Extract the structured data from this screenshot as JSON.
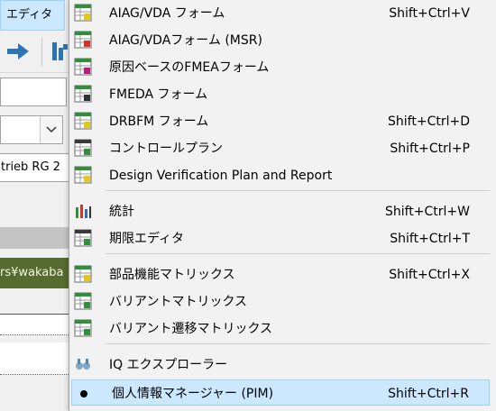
{
  "window": {
    "menu_tab": "エディタ",
    "partial_text_field": "trieb RG 2",
    "partial_path": "rs¥wakaba"
  },
  "menu": {
    "items": [
      {
        "label": "AIAG/VDA フォーム",
        "shortcut": "Shift+Ctrl+V",
        "icon": "aiag-vda-form-icon"
      },
      {
        "label": "AIAG/VDAフォーム (MSR)",
        "shortcut": "",
        "icon": "aiag-vda-msr-form-icon"
      },
      {
        "label": "原因ベースのFMEAフォーム",
        "shortcut": "",
        "icon": "cause-based-fmea-form-icon"
      },
      {
        "label": "FMEDA フォーム",
        "shortcut": "",
        "icon": "fmeda-form-icon"
      },
      {
        "label": "DRBFM フォーム",
        "shortcut": "Shift+Ctrl+D",
        "icon": "drbfm-form-icon"
      },
      {
        "label": "コントロールプラン",
        "shortcut": "Shift+Ctrl+P",
        "icon": "control-plan-icon"
      },
      {
        "label": "Design Verification Plan and Report",
        "shortcut": "",
        "icon": "dvpr-icon"
      },
      {
        "label": "統計",
        "shortcut": "Shift+Ctrl+W",
        "icon": "statistics-icon"
      },
      {
        "label": "期限エディタ",
        "shortcut": "Shift+Ctrl+T",
        "icon": "deadline-editor-icon"
      },
      {
        "label": "部品機能マトリックス",
        "shortcut": "Shift+Ctrl+X",
        "icon": "part-function-matrix-icon"
      },
      {
        "label": "バリアントマトリックス",
        "shortcut": "",
        "icon": "variant-matrix-icon"
      },
      {
        "label": "バリアント遷移マトリックス",
        "shortcut": "",
        "icon": "variant-transition-matrix-icon"
      },
      {
        "label": "IQ エクスプローラー",
        "shortcut": "",
        "icon": "iq-explorer-icon"
      },
      {
        "label": "個人情報マネージャー (PIM)",
        "shortcut": "Shift+Ctrl+R",
        "icon": "bullet-icon",
        "highlighted": true
      }
    ]
  },
  "colors": {
    "menu_background": "#f2f2f2",
    "highlight": "#cce8ff",
    "highlight_border": "#99d1ff",
    "path_bar": "#556b2f"
  }
}
